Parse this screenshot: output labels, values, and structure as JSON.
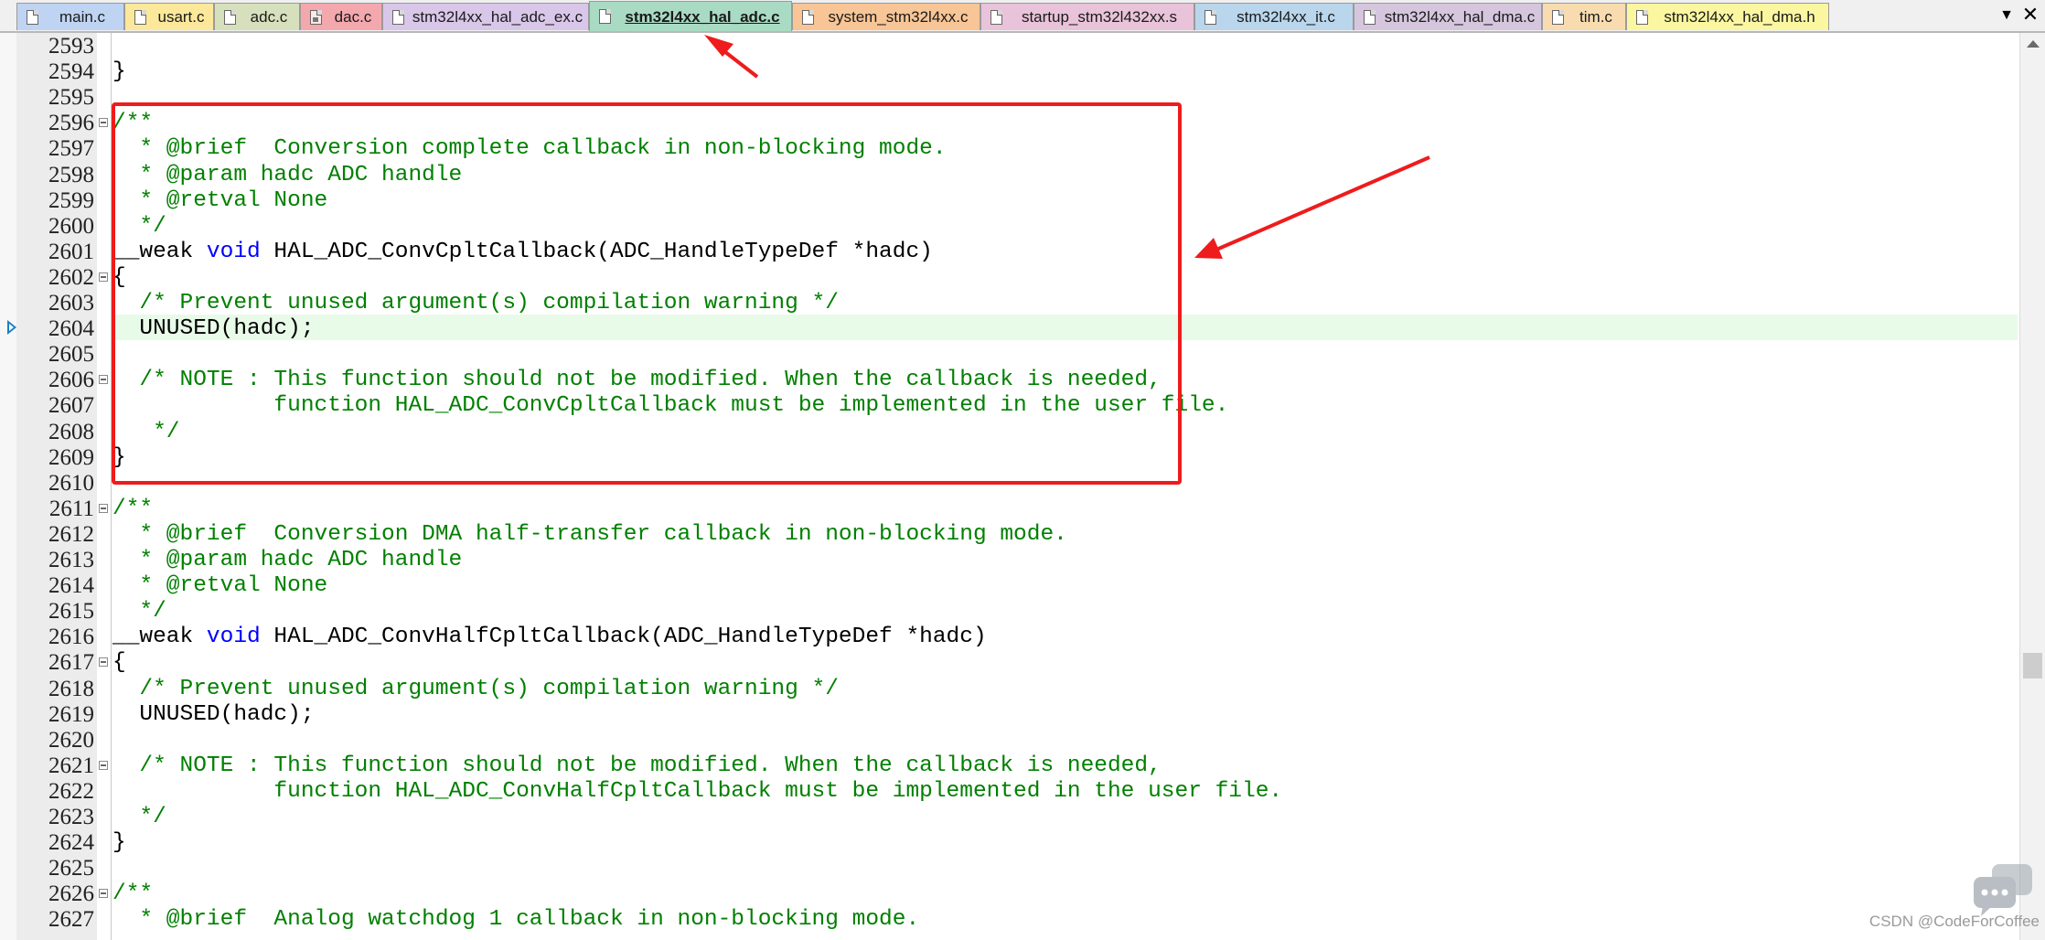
{
  "tabs": [
    {
      "label": "main.c",
      "color": "#bfd4f2",
      "icon": "c-file-icon"
    },
    {
      "label": "usart.c",
      "color": "#fbe89a",
      "icon": "c-file-icon"
    },
    {
      "label": "adc.c",
      "color": "#d6e0bc",
      "icon": "c-file-icon"
    },
    {
      "label": "dac.c",
      "color": "#f3a8ae",
      "icon": "locked-file-icon"
    },
    {
      "label": "stm32l4xx_hal_adc_ex.c",
      "color": "#d9c7e9",
      "icon": "c-file-icon"
    },
    {
      "label": "stm32l4xx_hal_adc.c",
      "color": "#a9dbc4",
      "icon": "c-file-icon",
      "active": true
    },
    {
      "label": "system_stm32l4xx.c",
      "color": "#f8c596",
      "icon": "c-file-icon"
    },
    {
      "label": "startup_stm32l432xx.s",
      "color": "#e9c3d9",
      "icon": "s-file-icon"
    },
    {
      "label": "stm32l4xx_it.c",
      "color": "#b9d6ec",
      "icon": "c-file-icon"
    },
    {
      "label": "stm32l4xx_hal_dma.c",
      "color": "#d5c6de",
      "icon": "c-file-icon"
    },
    {
      "label": "tim.c",
      "color": "#f8dcb0",
      "icon": "c-file-icon"
    },
    {
      "label": "stm32l4xx_hal_dma.h",
      "color": "#fbf6a0",
      "icon": "h-file-icon"
    }
  ],
  "tabbar_buttons": {
    "list": "▼",
    "close": "✕"
  },
  "code": {
    "current_line": "2604",
    "lines": [
      {
        "n": "2593",
        "t": [
          {
            "s": " "
          }
        ]
      },
      {
        "n": "2594",
        "t": [
          {
            "s": "}"
          }
        ]
      },
      {
        "n": "2595",
        "t": [
          {
            "s": " "
          }
        ]
      },
      {
        "n": "2596",
        "fold": true,
        "t": [
          {
            "s": "/**",
            "c": "cm"
          }
        ]
      },
      {
        "n": "2597",
        "t": [
          {
            "s": "  * @brief  Conversion complete callback in non-blocking mode.",
            "c": "cm"
          }
        ]
      },
      {
        "n": "2598",
        "t": [
          {
            "s": "  * @param hadc ADC handle",
            "c": "cm"
          }
        ]
      },
      {
        "n": "2599",
        "t": [
          {
            "s": "  * @retval None",
            "c": "cm"
          }
        ]
      },
      {
        "n": "2600",
        "t": [
          {
            "s": "  */",
            "c": "cm"
          }
        ]
      },
      {
        "n": "2601",
        "t": [
          {
            "s": "__weak "
          },
          {
            "s": "void",
            "c": "kw"
          },
          {
            "s": " HAL_ADC_ConvCpltCallback(ADC_HandleTypeDef *hadc)"
          }
        ]
      },
      {
        "n": "2602",
        "fold": true,
        "t": [
          {
            "s": "{"
          }
        ]
      },
      {
        "n": "2603",
        "t": [
          {
            "s": "  /* Prevent unused argument(s) compilation warning */",
            "c": "cm"
          }
        ]
      },
      {
        "n": "2604",
        "t": [
          {
            "s": "  UNUSED(hadc);"
          }
        ]
      },
      {
        "n": "2605",
        "t": [
          {
            "s": " "
          }
        ]
      },
      {
        "n": "2606",
        "fold": true,
        "t": [
          {
            "s": "  /* NOTE : This function should not be modified. When the callback is needed,",
            "c": "cm"
          }
        ]
      },
      {
        "n": "2607",
        "t": [
          {
            "s": "            function HAL_ADC_ConvCpltCallback must be implemented in the user file.",
            "c": "cm"
          }
        ]
      },
      {
        "n": "2608",
        "t": [
          {
            "s": "   */",
            "c": "cm"
          }
        ]
      },
      {
        "n": "2609",
        "t": [
          {
            "s": "}"
          }
        ]
      },
      {
        "n": "2610",
        "t": [
          {
            "s": " "
          }
        ]
      },
      {
        "n": "2611",
        "fold": true,
        "t": [
          {
            "s": "/**",
            "c": "cm"
          }
        ]
      },
      {
        "n": "2612",
        "t": [
          {
            "s": "  * @brief  Conversion DMA half-transfer callback in non-blocking mode.",
            "c": "cm"
          }
        ]
      },
      {
        "n": "2613",
        "t": [
          {
            "s": "  * @param hadc ADC handle",
            "c": "cm"
          }
        ]
      },
      {
        "n": "2614",
        "t": [
          {
            "s": "  * @retval None",
            "c": "cm"
          }
        ]
      },
      {
        "n": "2615",
        "t": [
          {
            "s": "  */",
            "c": "cm"
          }
        ]
      },
      {
        "n": "2616",
        "t": [
          {
            "s": "__weak "
          },
          {
            "s": "void",
            "c": "kw"
          },
          {
            "s": " HAL_ADC_ConvHalfCpltCallback(ADC_HandleTypeDef *hadc)"
          }
        ]
      },
      {
        "n": "2617",
        "fold": true,
        "t": [
          {
            "s": "{"
          }
        ]
      },
      {
        "n": "2618",
        "t": [
          {
            "s": "  /* Prevent unused argument(s) compilation warning */",
            "c": "cm"
          }
        ]
      },
      {
        "n": "2619",
        "t": [
          {
            "s": "  UNUSED(hadc);"
          }
        ]
      },
      {
        "n": "2620",
        "t": [
          {
            "s": " "
          }
        ]
      },
      {
        "n": "2621",
        "fold": true,
        "t": [
          {
            "s": "  /* NOTE : This function should not be modified. When the callback is needed,",
            "c": "cm"
          }
        ]
      },
      {
        "n": "2622",
        "t": [
          {
            "s": "            function HAL_ADC_ConvHalfCpltCallback must be implemented in the user file.",
            "c": "cm"
          }
        ]
      },
      {
        "n": "2623",
        "t": [
          {
            "s": "  */",
            "c": "cm"
          }
        ]
      },
      {
        "n": "2624",
        "t": [
          {
            "s": "}"
          }
        ]
      },
      {
        "n": "2625",
        "t": [
          {
            "s": " "
          }
        ]
      },
      {
        "n": "2626",
        "fold": true,
        "t": [
          {
            "s": "/**",
            "c": "cm"
          }
        ]
      },
      {
        "n": "2627",
        "t": [
          {
            "s": "  * @brief  Analog watchdog 1 callback in non-blocking mode.",
            "c": "cm"
          }
        ]
      }
    ]
  },
  "colors": {
    "comment": "#008000",
    "keyword": "#0000ff",
    "annotation": "#ee1c1c",
    "current_line": "#e8fbe8"
  },
  "watermark": {
    "text": "CSDN @CodeForCoffee",
    "icon": "chat-bubble-icon"
  }
}
